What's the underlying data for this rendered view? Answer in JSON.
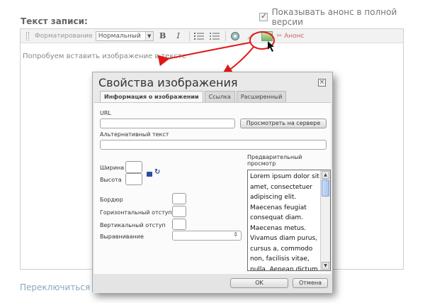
{
  "page": {
    "show_full_label": "Показывать анонс в полной версии",
    "field_label": "Текст записи:",
    "switch_link": "Переключиться в п"
  },
  "toolbar": {
    "format_label": "Форматирование",
    "format_value": "Нормальный",
    "bold_label": "B",
    "italic_label": "I",
    "anons_label": "Анонс"
  },
  "editor": {
    "content": "Попробуем вставить изображение в тексте"
  },
  "dialog": {
    "title": "Свойства изображения",
    "close_glyph": "×",
    "tabs": [
      {
        "label": "Информация о изображении",
        "active": true
      },
      {
        "label": "Ссылка",
        "active": false
      },
      {
        "label": "Расширенный",
        "active": false
      }
    ],
    "url_label": "URL",
    "url_value": "",
    "browse_label": "Просмотреть на сервере",
    "alt_label": "Альтернативный текст",
    "alt_value": "",
    "width_label": "Ширина",
    "height_label": "Высота",
    "border_label": "Бордюр",
    "hspace_label": "Горизонтальный отступ",
    "vspace_label": "Вертикальный отступ",
    "align_label": "Выравнивание",
    "align_value": "",
    "preview_label": "Предварительный просмотр",
    "preview_text": "Lorem ipsum dolor sit amet, consectetuer adipiscing elit. Maecenas feugiat consequat diam. Maecenas metus. Vivamus diam purus, cursus a, commodo non, facilisis vitae, nulla. Aenean dictum",
    "ok_label": "OK",
    "cancel_label": "Отмена"
  },
  "colors": {
    "annotation_red": "#e01818",
    "link_color": "#88aabb",
    "lock_blue": "#2a4f9a"
  }
}
